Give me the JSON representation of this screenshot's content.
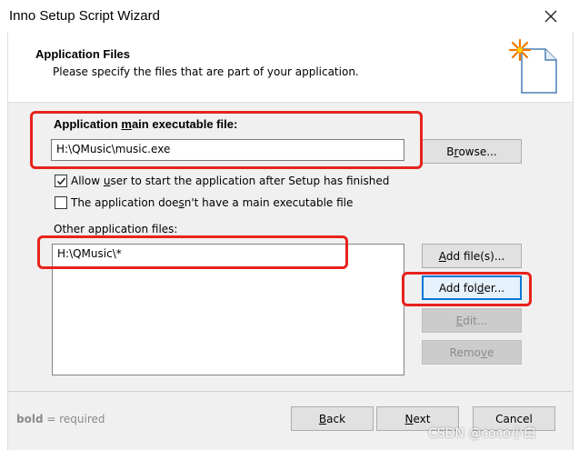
{
  "window": {
    "title": "Inno Setup Script Wizard"
  },
  "header": {
    "title": "Application Files",
    "subtitle": "Please specify the files that are part of your application."
  },
  "main_exe": {
    "label_pre": "Application ",
    "label_mnemonic": "m",
    "label_post": "ain executable file:",
    "value": "H:\\QMusic\\music.exe",
    "browse_pre": "B",
    "browse_mnemonic": "r",
    "browse_post": "owse..."
  },
  "options": {
    "allow_start": {
      "pre": "Allow ",
      "mnemonic": "u",
      "post": "ser to start the application after Setup has finished",
      "checked": true
    },
    "no_main_exe": {
      "pre": "The application doe",
      "mnemonic": "s",
      "post": "n't have a main executable file",
      "checked": false
    }
  },
  "other_files": {
    "label": "Other application files:",
    "items": [
      "H:\\QMusic\\*"
    ],
    "add_files": {
      "pre": "",
      "mnemonic": "A",
      "post": "dd file(s)..."
    },
    "add_folder": {
      "pre": "Add fol",
      "mnemonic": "d",
      "post": "er..."
    },
    "edit": {
      "pre": "",
      "mnemonic": "E",
      "post": "dit..."
    },
    "remove": {
      "pre": "Remo",
      "mnemonic": "v",
      "post": "e"
    }
  },
  "footer": {
    "hint_bold": "bold",
    "hint_rest": " = required",
    "back": {
      "pre": "",
      "mnemonic": "B",
      "post": "ack"
    },
    "next": {
      "pre": "",
      "mnemonic": "N",
      "post": "ext"
    },
    "cancel": "Cancel"
  },
  "watermark": "CSDN @coco小白",
  "colors": {
    "highlight_red": "#e8231c",
    "focus_blue": "#0078d7",
    "icon_star": "#f07800"
  }
}
